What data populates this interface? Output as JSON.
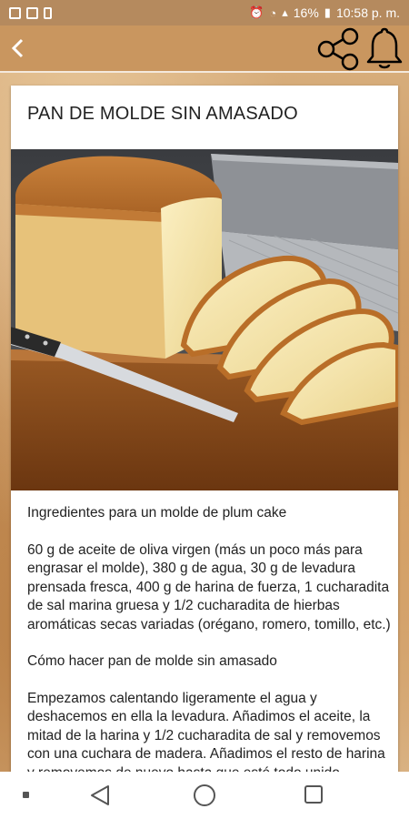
{
  "status_bar": {
    "battery": "16%",
    "time": "10:58 p. m."
  },
  "app_bar": {
    "back_icon": "back-arrow-icon",
    "share_icon": "share-icon",
    "bell_icon": "bell-icon"
  },
  "recipe": {
    "title": "PAN DE MOLDE SIN AMASADO",
    "paragraphs": [
      "Ingredientes para un molde de plum cake",
      "60 g de aceite de oliva virgen (más un poco más para engrasar el molde), 380 g de agua, 30 g de levadura prensada fresca, 400 g de harina de fuerza, 1 cucharadita de sal marina gruesa y 1/2 cucharadita de hierbas aromáticas secas variadas (orégano, romero, tomillo, etc.)",
      "Cómo hacer pan de molde sin amasado",
      "Empezamos calentando ligeramente el agua y deshacemos en ella la levadura. Añadimos el aceite, la mitad de la harina y 1/2 cucharadita de sal y removemos con una cuchara de madera. Añadimos el resto de harina y removemos de nuevo hasta que esté todo unido. Engrasamos un molde de plum cake con un"
    ]
  },
  "colors": {
    "app_bar": "#c9965f",
    "status_bar": "#b58a5e"
  }
}
